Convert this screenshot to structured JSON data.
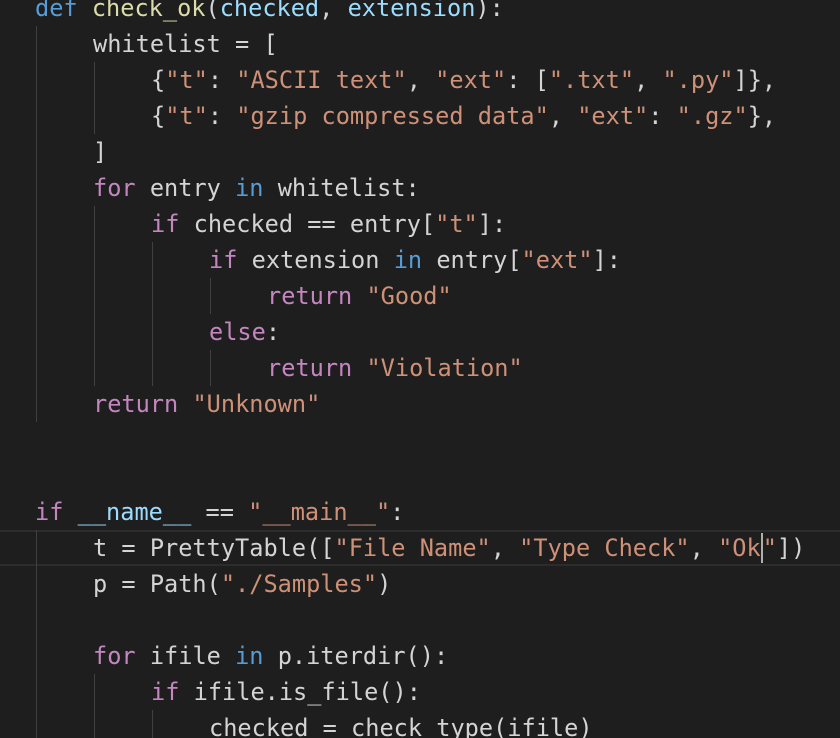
{
  "editor": {
    "colors": {
      "background": "#1e1e1e",
      "keyword_control": "#c586c0",
      "keyword": "#569cd6",
      "function": "#dcdcaa",
      "string": "#ce9178",
      "parameter": "#9cdcfe",
      "plain": "#d4d4d4",
      "indent_guide": "#404040",
      "cursor": "#aeafad"
    },
    "lines": [
      {
        "indent": 0,
        "tokens": [
          [
            "kw2",
            "def"
          ],
          [
            "pl",
            " "
          ],
          [
            "fn",
            "check_ok"
          ],
          [
            "pl",
            "("
          ],
          [
            "pr",
            "checked"
          ],
          [
            "pl",
            ", "
          ],
          [
            "pr",
            "extension"
          ],
          [
            "pl",
            "):"
          ]
        ]
      },
      {
        "indent": 1,
        "tokens": [
          [
            "pl",
            "whitelist = ["
          ]
        ]
      },
      {
        "indent": 2,
        "tokens": [
          [
            "pl",
            "{"
          ],
          [
            "st",
            "\"t\""
          ],
          [
            "pl",
            ": "
          ],
          [
            "st",
            "\"ASCII text\""
          ],
          [
            "pl",
            ", "
          ],
          [
            "st",
            "\"ext\""
          ],
          [
            "pl",
            ": ["
          ],
          [
            "st",
            "\".txt\""
          ],
          [
            "pl",
            ", "
          ],
          [
            "st",
            "\".py\""
          ],
          [
            "pl",
            "]},"
          ]
        ]
      },
      {
        "indent": 2,
        "tokens": [
          [
            "pl",
            "{"
          ],
          [
            "st",
            "\"t\""
          ],
          [
            "pl",
            ": "
          ],
          [
            "st",
            "\"gzip compressed data\""
          ],
          [
            "pl",
            ", "
          ],
          [
            "st",
            "\"ext\""
          ],
          [
            "pl",
            ": "
          ],
          [
            "st",
            "\".gz\""
          ],
          [
            "pl",
            "},"
          ]
        ]
      },
      {
        "indent": 1,
        "tokens": [
          [
            "pl",
            "]"
          ]
        ]
      },
      {
        "indent": 1,
        "tokens": [
          [
            "kw",
            "for"
          ],
          [
            "pl",
            " entry "
          ],
          [
            "kw2",
            "in"
          ],
          [
            "pl",
            " whitelist:"
          ]
        ]
      },
      {
        "indent": 2,
        "tokens": [
          [
            "kw",
            "if"
          ],
          [
            "pl",
            " checked == entry["
          ],
          [
            "st",
            "\"t\""
          ],
          [
            "pl",
            "]:"
          ]
        ]
      },
      {
        "indent": 3,
        "tokens": [
          [
            "kw",
            "if"
          ],
          [
            "pl",
            " extension "
          ],
          [
            "kw2",
            "in"
          ],
          [
            "pl",
            " entry["
          ],
          [
            "st",
            "\"ext\""
          ],
          [
            "pl",
            "]:"
          ]
        ]
      },
      {
        "indent": 4,
        "tokens": [
          [
            "kw",
            "return"
          ],
          [
            "pl",
            " "
          ],
          [
            "st",
            "\"Good\""
          ]
        ]
      },
      {
        "indent": 3,
        "tokens": [
          [
            "kw",
            "else"
          ],
          [
            "pl",
            ":"
          ]
        ]
      },
      {
        "indent": 4,
        "tokens": [
          [
            "kw",
            "return"
          ],
          [
            "pl",
            " "
          ],
          [
            "st",
            "\"Violation\""
          ]
        ]
      },
      {
        "indent": 1,
        "tokens": [
          [
            "kw",
            "return"
          ],
          [
            "pl",
            " "
          ],
          [
            "st",
            "\"Unknown\""
          ]
        ]
      },
      {
        "indent": 0,
        "tokens": []
      },
      {
        "indent": 0,
        "tokens": []
      },
      {
        "indent": 0,
        "tokens": [
          [
            "kw",
            "if"
          ],
          [
            "pl",
            " "
          ],
          [
            "pr",
            "__name__"
          ],
          [
            "pl",
            " == "
          ],
          [
            "st",
            "\"__main__\""
          ],
          [
            "pl",
            ":"
          ]
        ]
      },
      {
        "indent": 1,
        "current": true,
        "tokens": [
          [
            "pl",
            "t = PrettyTable(["
          ],
          [
            "st",
            "\"File Name\""
          ],
          [
            "pl",
            ", "
          ],
          [
            "st",
            "\"Type Check\""
          ],
          [
            "pl",
            ", "
          ],
          [
            "st",
            "\"Ok"
          ],
          [
            "cursor",
            ""
          ],
          [
            "st",
            "\""
          ],
          [
            "pl",
            "])"
          ]
        ]
      },
      {
        "indent": 1,
        "tokens": [
          [
            "pl",
            "p = Path("
          ],
          [
            "st",
            "\"./Samples\""
          ],
          [
            "pl",
            ")"
          ]
        ]
      },
      {
        "indent": 0,
        "tokens": []
      },
      {
        "indent": 1,
        "tokens": [
          [
            "kw",
            "for"
          ],
          [
            "pl",
            " ifile "
          ],
          [
            "kw2",
            "in"
          ],
          [
            "pl",
            " p.iterdir():"
          ]
        ]
      },
      {
        "indent": 2,
        "tokens": [
          [
            "kw",
            "if"
          ],
          [
            "pl",
            " ifile.is_file():"
          ]
        ]
      },
      {
        "indent": 3,
        "tokens": [
          [
            "pl",
            "checked = check_type(ifile)"
          ]
        ]
      }
    ]
  }
}
